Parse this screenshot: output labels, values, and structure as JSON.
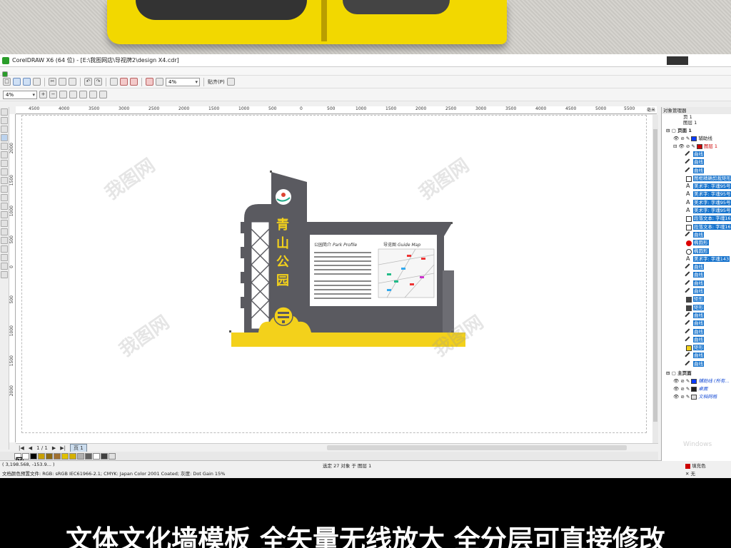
{
  "window": {
    "title": "CorelDRAW X6 (64 位) - [E:\\我图网店\\导视牌2\\design X4.cdr]"
  },
  "toolbar": {
    "zoom_value": "4%",
    "zoom_value2": "4%",
    "snap_label": "贴齐(P)"
  },
  "ruler_h": [
    "4500",
    "4000",
    "3500",
    "3000",
    "2500",
    "2000",
    "1500",
    "1000",
    "500",
    "0",
    "500",
    "1000",
    "1500",
    "2000",
    "2500",
    "3000",
    "3500",
    "4000",
    "4500",
    "5000",
    "5500",
    "毫米"
  ],
  "ruler_v": [
    "2000",
    "1500",
    "1000",
    "500",
    "0",
    "500",
    "1000",
    "1500",
    "2000"
  ],
  "design": {
    "name_chars": [
      "青",
      "山",
      "公",
      "园"
    ],
    "panel_left_title": "公园简介",
    "panel_left_title_en": "Park Profile",
    "panel_right_title": "导览图",
    "panel_right_title_en": "Guide Map"
  },
  "page_nav": {
    "count": "1 / 1",
    "tab": "页 1"
  },
  "status": {
    "coords": "( 3,198.568, -153.9... )",
    "color_profile": "文档颜色预置文件: RGB: sRGB IEC61966-2.1; CMYK: Japan Color 2001 Coated; 灰度: Dot Gain 15%",
    "selection": "选定 27 对象 于 图层 1",
    "fill_label": "填充色",
    "outline_label": "无"
  },
  "docker": {
    "title": "对象管理器",
    "page_label": "页 1",
    "layer_label": "图层 1",
    "group_page": "页面 1",
    "guides_layer": "辅助线",
    "layer1": "图层 1",
    "items": [
      {
        "label": "曲线",
        "sel": true,
        "glyph": "curve"
      },
      {
        "label": "曲线",
        "sel": true,
        "glyph": "curve"
      },
      {
        "label": "曲线",
        "sel": true,
        "glyph": "curve"
      },
      {
        "label": "图框精确剪裁矩形",
        "sel": true,
        "glyph": "rect"
      },
      {
        "label": "美术字: 字魂95号",
        "sel": true,
        "glyph": "text"
      },
      {
        "label": "美术字: 字魂95号",
        "sel": true,
        "glyph": "text"
      },
      {
        "label": "美术字: 字魂95号",
        "sel": true,
        "glyph": "text"
      },
      {
        "label": "美术字: 字魂95号",
        "sel": true,
        "glyph": "text"
      },
      {
        "label": "段落文本: 字魂16",
        "sel": true,
        "glyph": "para"
      },
      {
        "label": "段落文本: 字魂16",
        "sel": true,
        "glyph": "para"
      },
      {
        "label": "曲线",
        "sel": true,
        "glyph": "curve"
      },
      {
        "label": "椭圆形",
        "sel": true,
        "glyph": "ellipse-red"
      },
      {
        "label": "椭圆形",
        "sel": true,
        "glyph": "ellipse"
      },
      {
        "label": "美术字: 字魂143",
        "sel": true,
        "glyph": "text"
      },
      {
        "label": "曲线",
        "sel": true,
        "glyph": "curve"
      },
      {
        "label": "曲线",
        "sel": true,
        "glyph": "curve"
      },
      {
        "label": "曲线",
        "sel": true,
        "glyph": "curve"
      },
      {
        "label": "曲线",
        "sel": true,
        "glyph": "curve"
      },
      {
        "label": "矩形",
        "sel": true,
        "glyph": "rect-dark"
      },
      {
        "label": "矩形",
        "sel": true,
        "glyph": "rect-dark"
      },
      {
        "label": "曲线",
        "sel": true,
        "glyph": "curve"
      },
      {
        "label": "曲线",
        "sel": true,
        "glyph": "curve"
      },
      {
        "label": "曲线",
        "sel": true,
        "glyph": "curve"
      },
      {
        "label": "曲线",
        "sel": true,
        "glyph": "curve"
      },
      {
        "label": "矩形",
        "sel": true,
        "glyph": "rect-yellow"
      },
      {
        "label": "曲线",
        "sel": true,
        "glyph": "curve"
      },
      {
        "label": "曲线",
        "sel": true,
        "glyph": "curve"
      }
    ],
    "group_master": "主页面",
    "master_layers": [
      "辅助线 (所有…",
      "桌面",
      "文档网格"
    ],
    "ghost_text": "Windows"
  },
  "palette_colors": [
    "#ffffff",
    "#000000",
    "#c8a000",
    "#8b6914",
    "#a07030",
    "#e0c000",
    "#d4b000",
    "#b0b0b0",
    "#606060",
    "#ffffff",
    "#404040",
    "#e0e0e0"
  ],
  "banner": {
    "caption": "文体文化墙模板  全矢量无线放大 全分层可直接修改"
  },
  "colors": {
    "sign_gray": "#5a5a60",
    "sign_yellow": "#f3d11b",
    "selection_blue": "#1874cd"
  }
}
